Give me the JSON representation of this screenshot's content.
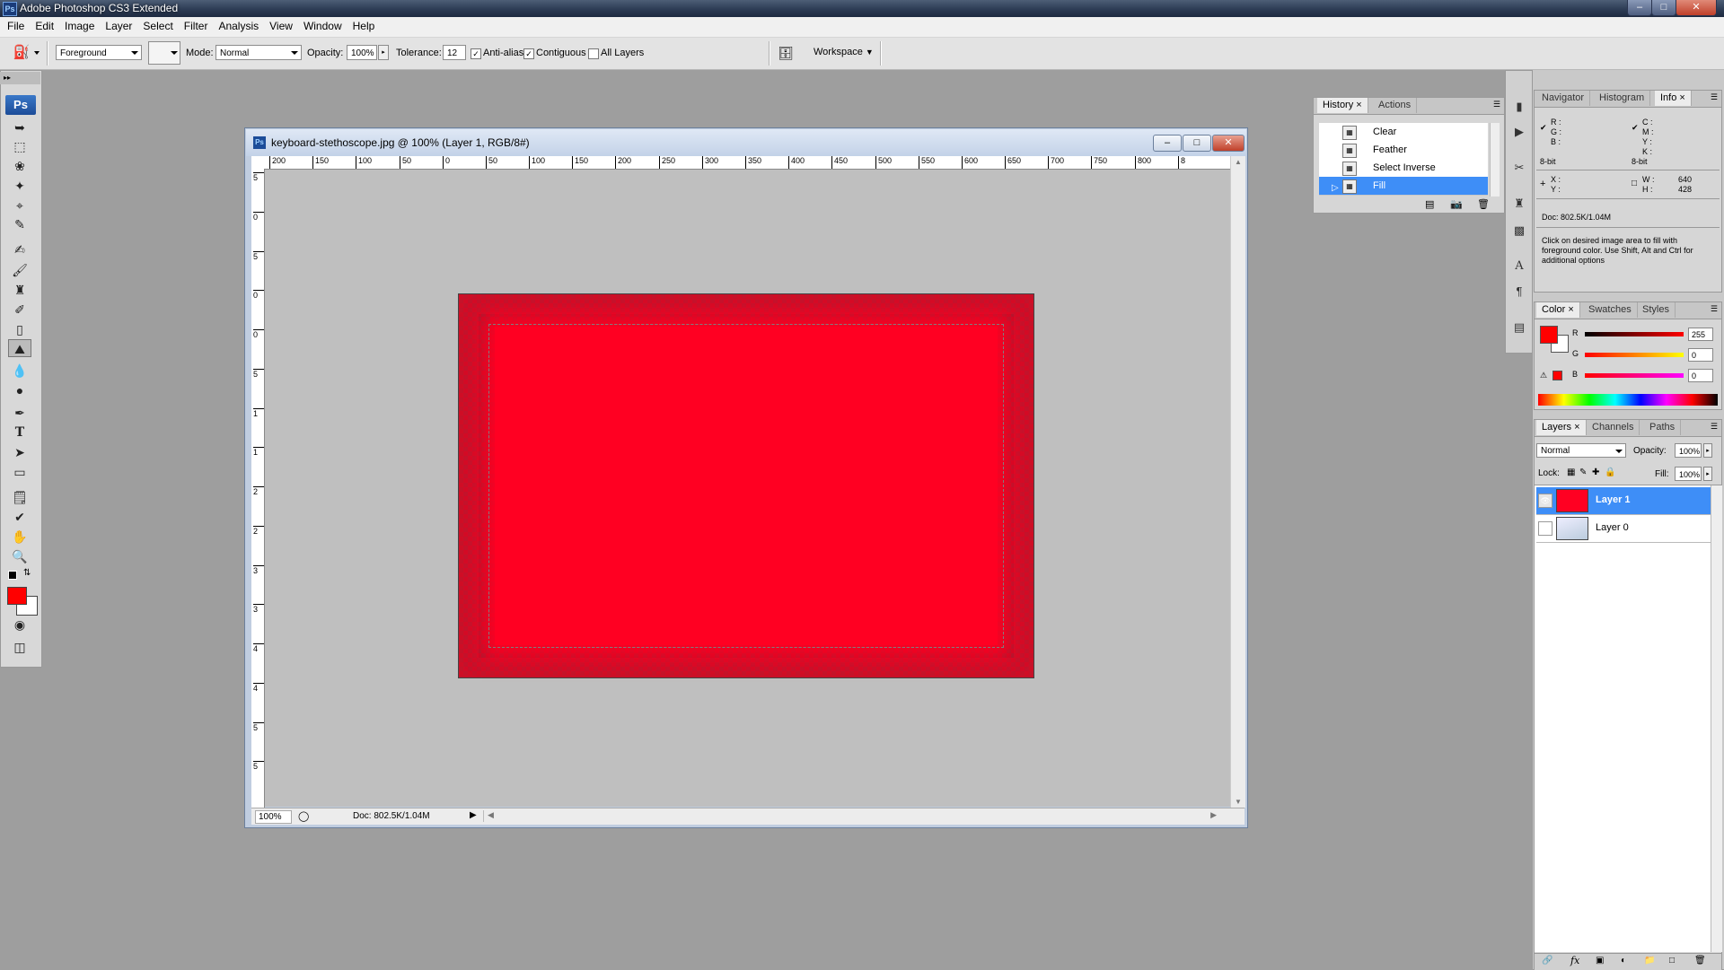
{
  "app": {
    "title": "Adobe Photoshop CS3 Extended",
    "logo": "Ps"
  },
  "window_controls": {
    "minimize": "–",
    "maximize": "□",
    "close": "✕"
  },
  "menu": [
    "File",
    "Edit",
    "Image",
    "Layer",
    "Select",
    "Filter",
    "Analysis",
    "View",
    "Window",
    "Help"
  ],
  "options_bar": {
    "tool_icon": "paint-bucket-icon",
    "source": "Foreground",
    "mode_label": "Mode:",
    "mode_value": "Normal",
    "opacity_label": "Opacity:",
    "opacity_value": "100%",
    "tolerance_label": "Tolerance:",
    "tolerance_value": "12",
    "antialias_label": "Anti-alias",
    "antialias_checked": true,
    "contiguous_label": "Contiguous",
    "contiguous_checked": true,
    "all_layers_label": "All Layers",
    "all_layers_checked": false,
    "workspace_label": "Workspace"
  },
  "document": {
    "title": "keyboard-stethoscope.jpg @ 100% (Layer 1, RGB/8#)",
    "zoom": "100%",
    "doc_size": "Doc: 802.5K/1.04M",
    "hruler_labels": [
      "200",
      "150",
      "100",
      "50",
      "0",
      "50",
      "100",
      "150",
      "200",
      "250",
      "300",
      "350",
      "400",
      "450",
      "500",
      "550",
      "600",
      "650",
      "700",
      "750",
      "800",
      "8"
    ],
    "vruler_labels": [
      "5",
      "0",
      "5",
      "0",
      "0",
      "5",
      "1",
      "1",
      "2",
      "2",
      "3",
      "3",
      "4",
      "4",
      "5",
      "5"
    ]
  },
  "history": {
    "tabs": [
      "History",
      "Actions"
    ],
    "items": [
      {
        "label": "Clear",
        "selected": false
      },
      {
        "label": "Feather",
        "selected": false
      },
      {
        "label": "Select Inverse",
        "selected": false
      },
      {
        "label": "Fill",
        "selected": true
      }
    ]
  },
  "info": {
    "tabs": [
      "Navigator",
      "Histogram",
      "Info"
    ],
    "rgb_labels": [
      "R :",
      "G :",
      "B :"
    ],
    "cmyk_labels": [
      "C :",
      "M :",
      "Y :",
      "K :"
    ],
    "bit_left": "8-bit",
    "bit_right": "8-bit",
    "xy_labels": [
      "X :",
      "Y :"
    ],
    "w_label": "W :",
    "h_label": "H :",
    "w_value": "640",
    "h_value": "428",
    "doc": "Doc: 802.5K/1.04M",
    "hint": "Click on desired image area to fill with foreground color.  Use Shift, Alt and Ctrl for additional options"
  },
  "color": {
    "tabs": [
      "Color",
      "Swatches",
      "Styles"
    ],
    "r_label": "R",
    "g_label": "G",
    "b_label": "B",
    "r_value": "255",
    "g_value": "0",
    "b_value": "0",
    "foreground": "#ff0000",
    "background": "#ffffff"
  },
  "layers": {
    "tabs": [
      "Layers",
      "Channels",
      "Paths"
    ],
    "blend_mode": "Normal",
    "opacity_label": "Opacity:",
    "opacity_value": "100%",
    "lock_label": "Lock:",
    "fill_label": "Fill:",
    "fill_value": "100%",
    "items": [
      {
        "name": "Layer 1",
        "selected": true,
        "visible": true
      },
      {
        "name": "Layer 0",
        "selected": false,
        "visible": false
      }
    ]
  },
  "colors": {
    "selection_blue": "#3e8ef7",
    "fill_red": "#ff0022"
  }
}
